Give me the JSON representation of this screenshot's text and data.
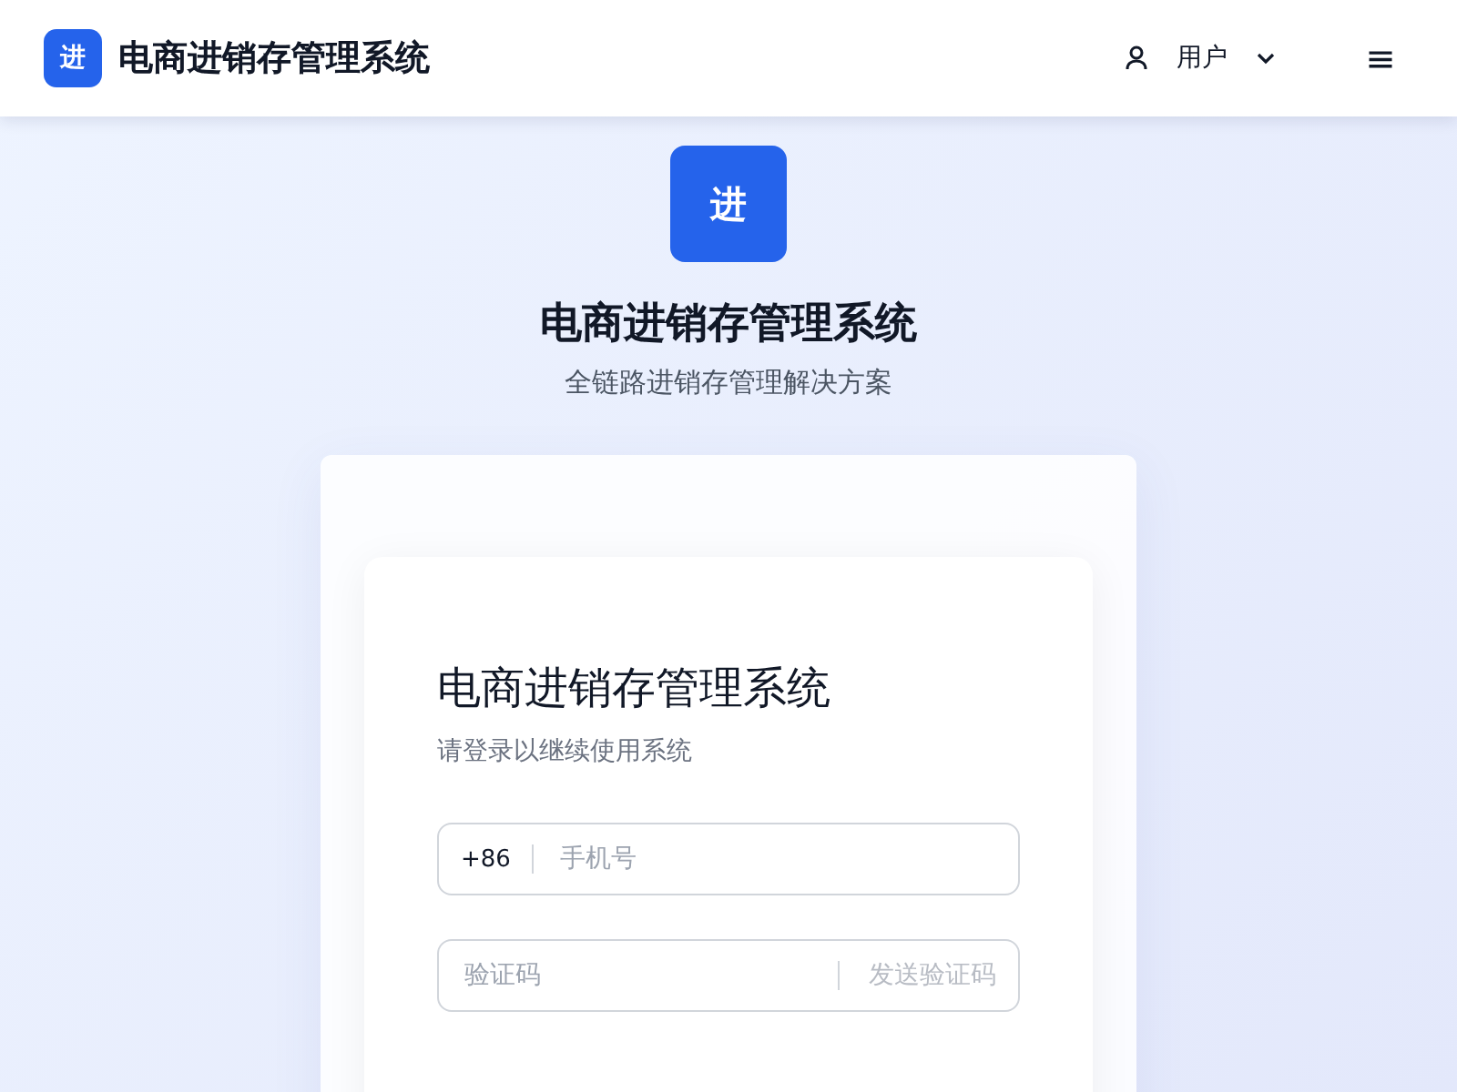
{
  "header": {
    "logo": "进",
    "title": "电商进销存管理系统",
    "user": "用户",
    "menu_icon": "≡"
  },
  "hero": {
    "logo": "进",
    "title": "电商进销存管理系统",
    "subtitle": "全链路进销存管理解决方案"
  },
  "login": {
    "title": "电商进销存管理系统",
    "subtitle": "请登录以继续使用系统",
    "phone": {
      "prefix": "+86",
      "placeholder": "手机号"
    },
    "code": {
      "placeholder": "验证码",
      "send_button": {
        "label": "发送验证码",
        "disabled": true
      }
    }
  }
}
